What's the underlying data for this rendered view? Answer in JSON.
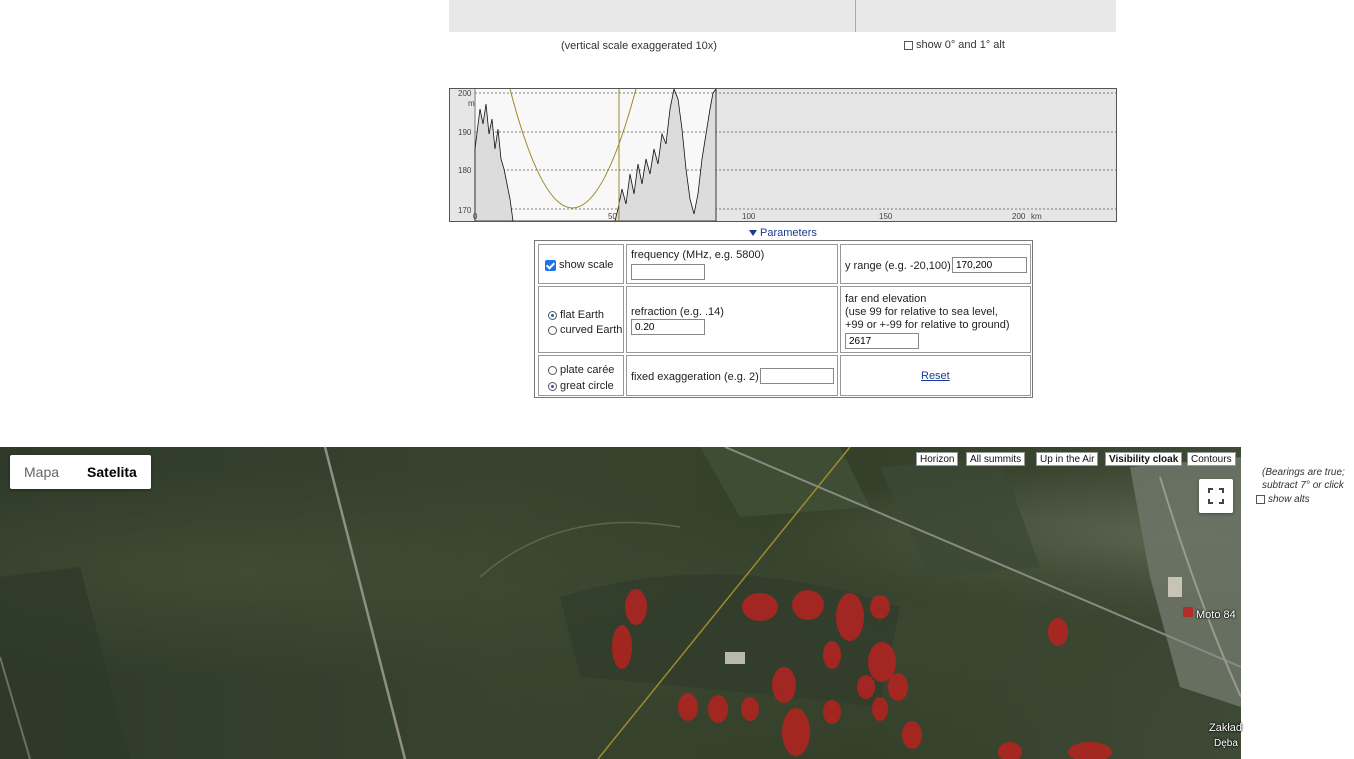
{
  "top": {
    "note": "(vertical scale exaggerated 10x)",
    "show_alt_label": "show 0° and 1° alt"
  },
  "profile": {
    "y_ticks": [
      "200",
      "190",
      "180",
      "170"
    ],
    "y_unit": "m",
    "x_ticks": [
      "0",
      "50",
      "100",
      "150",
      "200"
    ],
    "x_unit": "km"
  },
  "parameters": {
    "toggle_label": "Parameters",
    "show_scale_label": "show scale",
    "frequency_label": "frequency (MHz, e.g. 5800)",
    "frequency_value": "",
    "y_range_label": "y range (e.g. -20,100)",
    "y_range_value": "170,200",
    "flat_earth_label": "flat Earth",
    "curved_earth_label": "curved Earth",
    "refraction_label": "refraction (e.g. .14)",
    "refraction_value": "0.20",
    "far_end_label": "far end elevation",
    "far_end_help_1": "(use 99 for relative to sea level,",
    "far_end_help_2": "+99 or +-99 for relative to ground)",
    "far_end_value": "2617",
    "plate_caree_label": "plate carée",
    "great_circle_label": "great circle",
    "exaggeration_label": "fixed exaggeration (e.g. 2)",
    "exaggeration_value": "",
    "reset_label": "Reset"
  },
  "map": {
    "type_map": "Mapa",
    "type_satellite": "Satelita",
    "buttons": [
      "Horizon",
      "All summits",
      "Up in the Air",
      "Visibility cloak",
      "Contours"
    ],
    "label_moto": "Moto 84",
    "label_zaklad": "Zakład",
    "label_deba": "Dęba"
  },
  "side": {
    "bearing_line1": "(Bearings are true;",
    "bearing_line2": "subtract 7° or click",
    "show_alts_label": "show alts"
  }
}
